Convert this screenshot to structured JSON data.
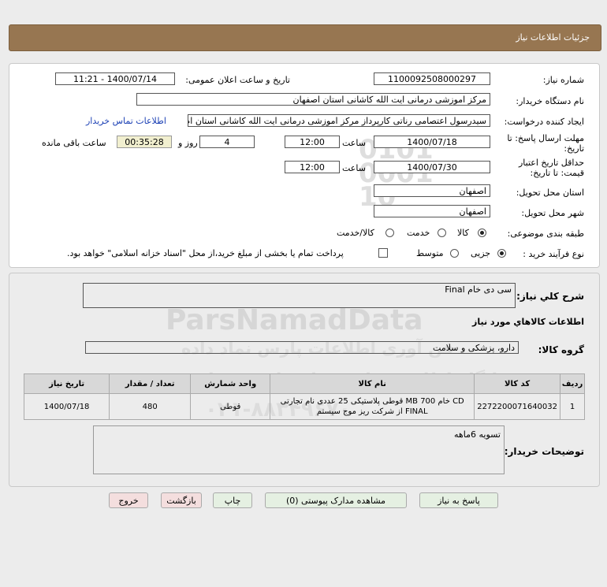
{
  "header": {
    "title": "جزئیات اطلاعات نیاز"
  },
  "form": {
    "need_number_label": "شماره نیاز:",
    "need_number": "1100092508000297",
    "announce_label": "تاریخ و ساعت اعلان عمومی:",
    "announce_value": "1400/07/14 - 11:21",
    "buyer_label": "نام دستگاه خریدار:",
    "buyer_value": "مرکز اموزشی درمانی ایت الله کاشانی استان اصفهان",
    "requester_label": "ایجاد کننده درخواست:",
    "requester_value": "سیدرسول اعتصامی رناتی کارپرداز مرکز اموزشی درمانی ایت الله کاشانی استان اصفهان",
    "contact_link": "اطلاعات تماس خریدار",
    "deadline_label": "مهلت ارسال پاسخ: تا تاریخ:",
    "deadline_date": "1400/07/18",
    "time_label": "ساعت",
    "deadline_time": "12:00",
    "days_value": "4",
    "days_label": "روز و",
    "remaining_time": "00:35:28",
    "remaining_label": "ساعت باقی مانده",
    "validity_label": "حداقل تاریخ اعتبار قیمت: تا تاریخ:",
    "validity_date": "1400/07/30",
    "validity_time_label": "ساعت",
    "validity_time": "12:00",
    "province_label": "استان محل تحویل:",
    "province_value": "اصفهان",
    "city_label": "شهر محل تحویل:",
    "city_value": "اصفهان",
    "category_label": "طبقه بندی موضوعی:",
    "category_options": [
      "کالا",
      "خدمت",
      "کالا/خدمت"
    ],
    "process_label": "نوع فرآیند خرید :",
    "process_options": [
      "جزیی",
      "متوسط"
    ],
    "payment_note": "پرداخت تمام یا بخشی از مبلغ خرید،از محل \"اسناد خزانه اسلامی\" خواهد بود."
  },
  "need": {
    "desc_label": "شرح کلي نياز:",
    "desc_value": "سی دی خام Final",
    "goods_info_label": "اطلاعات کالاهاي مورد نياز",
    "group_label": "گروه کالا:",
    "group_value": "دارو، پزشکی و سلامت",
    "table": {
      "headers": [
        "ردیف",
        "کد کالا",
        "نام کالا",
        "واحد شمارش",
        "تعداد / مقدار",
        "تاریخ نیاز"
      ],
      "rows": [
        [
          "1",
          "2272200071640032",
          "CD خام 700 MB قوطی پلاستیکی 25 عددی نام تجارتی FINAL از شرکت ریز موج سیستم",
          "قوطی",
          "480",
          "1400/07/18"
        ]
      ]
    },
    "buyer_notes_label": "توضیحات خریدار:",
    "buyer_notes_value": "تسویه 6ماهه"
  },
  "buttons": {
    "reply": "پاسخ به نیاز",
    "attachments": "مشاهده مدارک پیوستی (0)",
    "print": "چاپ",
    "back": "بازگشت",
    "exit": "خروج"
  },
  "watermark": {
    "brand": "ParsNamadData",
    "line1": "پایگاه اطلاع رسانی مناقصات و مزایده",
    "line2": "فن آوری اطلاعات پارس نماد داده",
    "phone": "۰۲۱-۸۸۳۴۹۶۷۰",
    "digits": "0101 0001 10"
  },
  "colors": {
    "header_bg": "#977651",
    "link": "#1a3fb4"
  }
}
